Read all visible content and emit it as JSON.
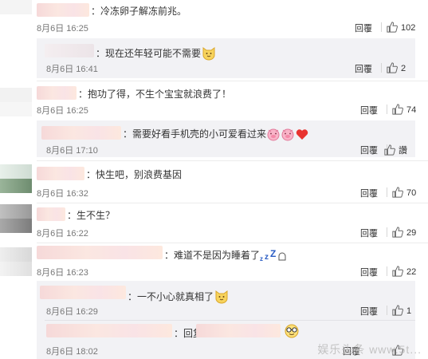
{
  "comments": [
    {
      "text": "：冷冻卵子解冻前兆。",
      "date": "8月6日 16:25",
      "reply": "回覆",
      "likes": "102"
    },
    {
      "text": "：现在还年轻可能不需要",
      "date": "8月6日 16:41",
      "reply": "回覆",
      "likes": "2"
    },
    {
      "text": "：抱功了得，不生个宝宝就浪费了！",
      "date": "8月6日 16:25",
      "reply": "回覆",
      "likes": "74"
    },
    {
      "text": "：需要好看手机壳的小可爱看过来",
      "date": "8月6日 17:10",
      "reply": "回覆",
      "likes": "讚"
    },
    {
      "text": "：快生吧，别浪费基因",
      "date": "8月6日 16:32",
      "reply": "回覆",
      "likes": "70"
    },
    {
      "text": "：生不生？",
      "date": "8月6日 16:22",
      "reply": "回覆",
      "likes": "29"
    },
    {
      "text": "：难道不是因为睡着了",
      "date": "8月6日 16:23",
      "reply": "回覆",
      "likes": "22"
    },
    {
      "text": "：一不小心就真相了",
      "date": "8月6日 16:29",
      "reply": "回覆",
      "likes": "1"
    },
    {
      "text": "：回复",
      "date": "8月6日 18:02",
      "reply": "回覆",
      "likes": ""
    }
  ],
  "watermark": "娱乐头条 www.5t..."
}
